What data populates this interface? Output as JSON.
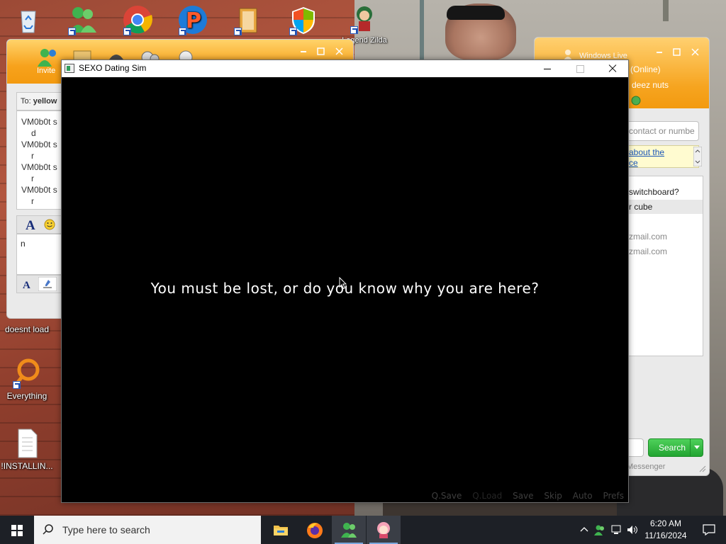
{
  "desktop": {
    "icons": [
      {
        "name": "recycle-bin",
        "label": ""
      },
      {
        "name": "windows-live-messenger",
        "label": ""
      },
      {
        "name": "google-chrome",
        "label": ""
      },
      {
        "name": "pp-app",
        "label": ""
      },
      {
        "name": "book-app",
        "label": ""
      },
      {
        "name": "windows-security",
        "label": ""
      },
      {
        "name": "legend-zilda",
        "label": "Legend Zilda"
      },
      {
        "name": "doesnt-load",
        "label": "doesnt load"
      },
      {
        "name": "everything",
        "label": "Everything"
      },
      {
        "name": "installing-file",
        "label": "!INSTALLIN..."
      }
    ]
  },
  "messenger_conversation": {
    "invite_label": "Invite",
    "to_label": "To:",
    "to_value": "yellow",
    "messages": [
      {
        "sender": "VM0b0t s",
        "text": "d"
      },
      {
        "sender": "VM0b0t s",
        "text": "r"
      },
      {
        "sender": "VM0b0t s",
        "text": "r"
      },
      {
        "sender": "VM0b0t s",
        "text": "r"
      }
    ],
    "input_text": "n"
  },
  "messenger_contacts": {
    "title": "Windows Live",
    "status": "(Online)",
    "personal_message": "deez nuts",
    "search_placeholder": "contact or numbe",
    "ad_text": "about the\nce",
    "list_rows": [
      "switchboard?",
      "r cube",
      "",
      "zmail.com",
      "zmail.com"
    ],
    "search_button": "Search",
    "footer": "Messenger"
  },
  "game_window": {
    "title": "SEXO Dating Sim",
    "dialogue": "You must be lost, or do you know why you are here?",
    "quick_menu": [
      "Q.Save",
      "Q.Load",
      "Save",
      "Skip",
      "Auto",
      "Prefs"
    ],
    "quick_menu_disabled": [
      "Q.Load"
    ]
  },
  "taskbar": {
    "search_placeholder": "Type here to search",
    "time": "6:20 AM",
    "date": "11/16/2024",
    "pinned_apps": [
      "file-explorer",
      "firefox",
      "windows-live-messenger",
      "sexo-dating-sim"
    ]
  },
  "colors": {
    "messenger_orange": "#f39a10",
    "search_green": "#22a431",
    "taskbar": "#1d2026",
    "game_bg": "#000000"
  }
}
